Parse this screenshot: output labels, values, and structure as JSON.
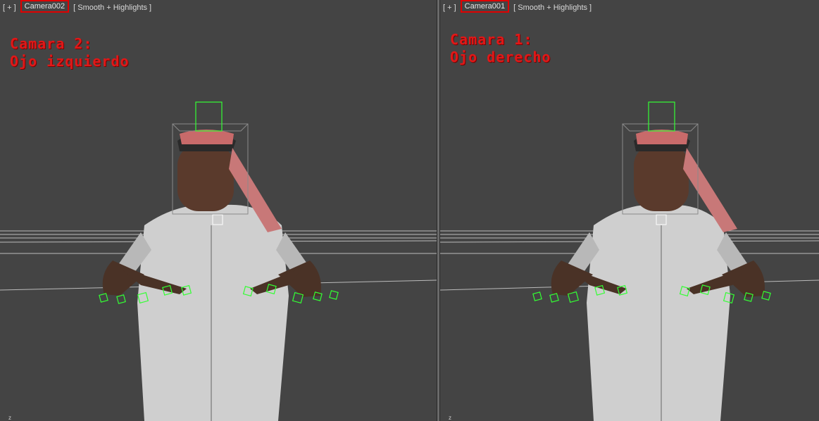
{
  "viewports": [
    {
      "menu_label": "[ + ]",
      "camera_label": "Camera002",
      "shading_label": "[ Smooth + Highlights ]",
      "annotation_line1": "Camara 2:",
      "annotation_line2": "Ojo izquierdo",
      "axis_label": "z"
    },
    {
      "menu_label": "[ + ]",
      "camera_label": "Camera001",
      "shading_label": "[ Smooth + Highlights ]",
      "annotation_line1": "Camara 1:",
      "annotation_line2": "Ojo derecho",
      "axis_label": "z"
    }
  ],
  "colors": {
    "background": "#444444",
    "annotation": "#e01818",
    "camera_highlight": "#e00000",
    "selection_helpers": "#33ff33",
    "grid": "#cfcfcf"
  }
}
